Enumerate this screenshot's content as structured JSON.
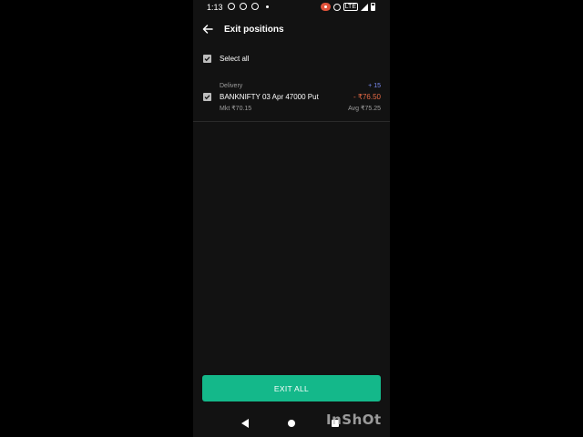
{
  "status_bar": {
    "time": "1:13",
    "network_label": "LTE",
    "left_icons": [
      "gear-icon",
      "chat-icon",
      "headset-icon",
      "dot-icon"
    ],
    "right_icons": [
      "record-icon",
      "hotspot-icon",
      "network-icon",
      "signal-icon",
      "battery-icon"
    ]
  },
  "header": {
    "title": "Exit positions",
    "back_icon": "arrow-left-icon"
  },
  "select_all": {
    "label": "Select all",
    "checked": true
  },
  "positions": [
    {
      "product": "Delivery",
      "quantity": "+ 15",
      "instrument": "BANKNIFTY 03 Apr 47000 Put",
      "pnl": "- ₹76.50",
      "mkt": "Mkt ₹70.15",
      "avg": "Avg ₹75.25",
      "checked": true
    }
  ],
  "footer": {
    "exit_all_label": "EXIT ALL"
  },
  "watermark": "InShOt",
  "colors": {
    "background": "#121212",
    "accent": "#14b88a",
    "loss": "#e86a45",
    "quantity": "#7b8cf5"
  }
}
